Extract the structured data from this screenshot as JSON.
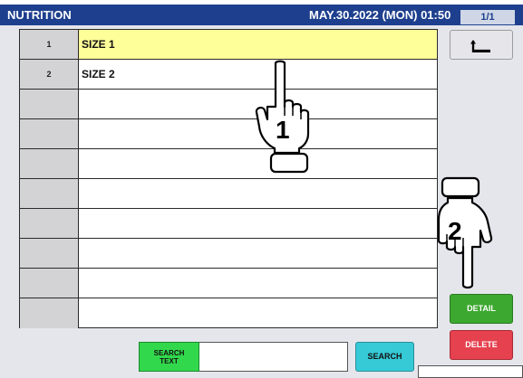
{
  "header": {
    "title": "NUTRITION",
    "datetime": "MAY.30.2022 (MON) 01:50",
    "page": "1/1"
  },
  "list": {
    "rows": [
      {
        "num": "1",
        "label": "SIZE 1",
        "selected": true
      },
      {
        "num": "2",
        "label": "SIZE 2",
        "selected": false
      },
      {
        "num": "",
        "label": ""
      },
      {
        "num": "",
        "label": ""
      },
      {
        "num": "",
        "label": ""
      },
      {
        "num": "",
        "label": ""
      },
      {
        "num": "",
        "label": ""
      },
      {
        "num": "",
        "label": ""
      },
      {
        "num": "",
        "label": ""
      },
      {
        "num": "",
        "label": ""
      }
    ]
  },
  "buttons": {
    "detail": "DETAIL",
    "delete": "DELETE",
    "search_text_line1": "SEARCH",
    "search_text_line2": "TEXT",
    "search": "SEARCH"
  },
  "search": {
    "value": ""
  },
  "annotations": {
    "step1": "1",
    "step2": "2"
  },
  "colors": {
    "header_bg": "#1d3f8e",
    "selected_row": "#ffff99",
    "detail_btn": "#3ca830",
    "delete_btn": "#e5414e",
    "search_text_btn": "#32d84c",
    "search_btn": "#36c9d6"
  },
  "icons": {
    "back": "back-arrow-icon",
    "pointer": "pointing-hand-icon"
  }
}
